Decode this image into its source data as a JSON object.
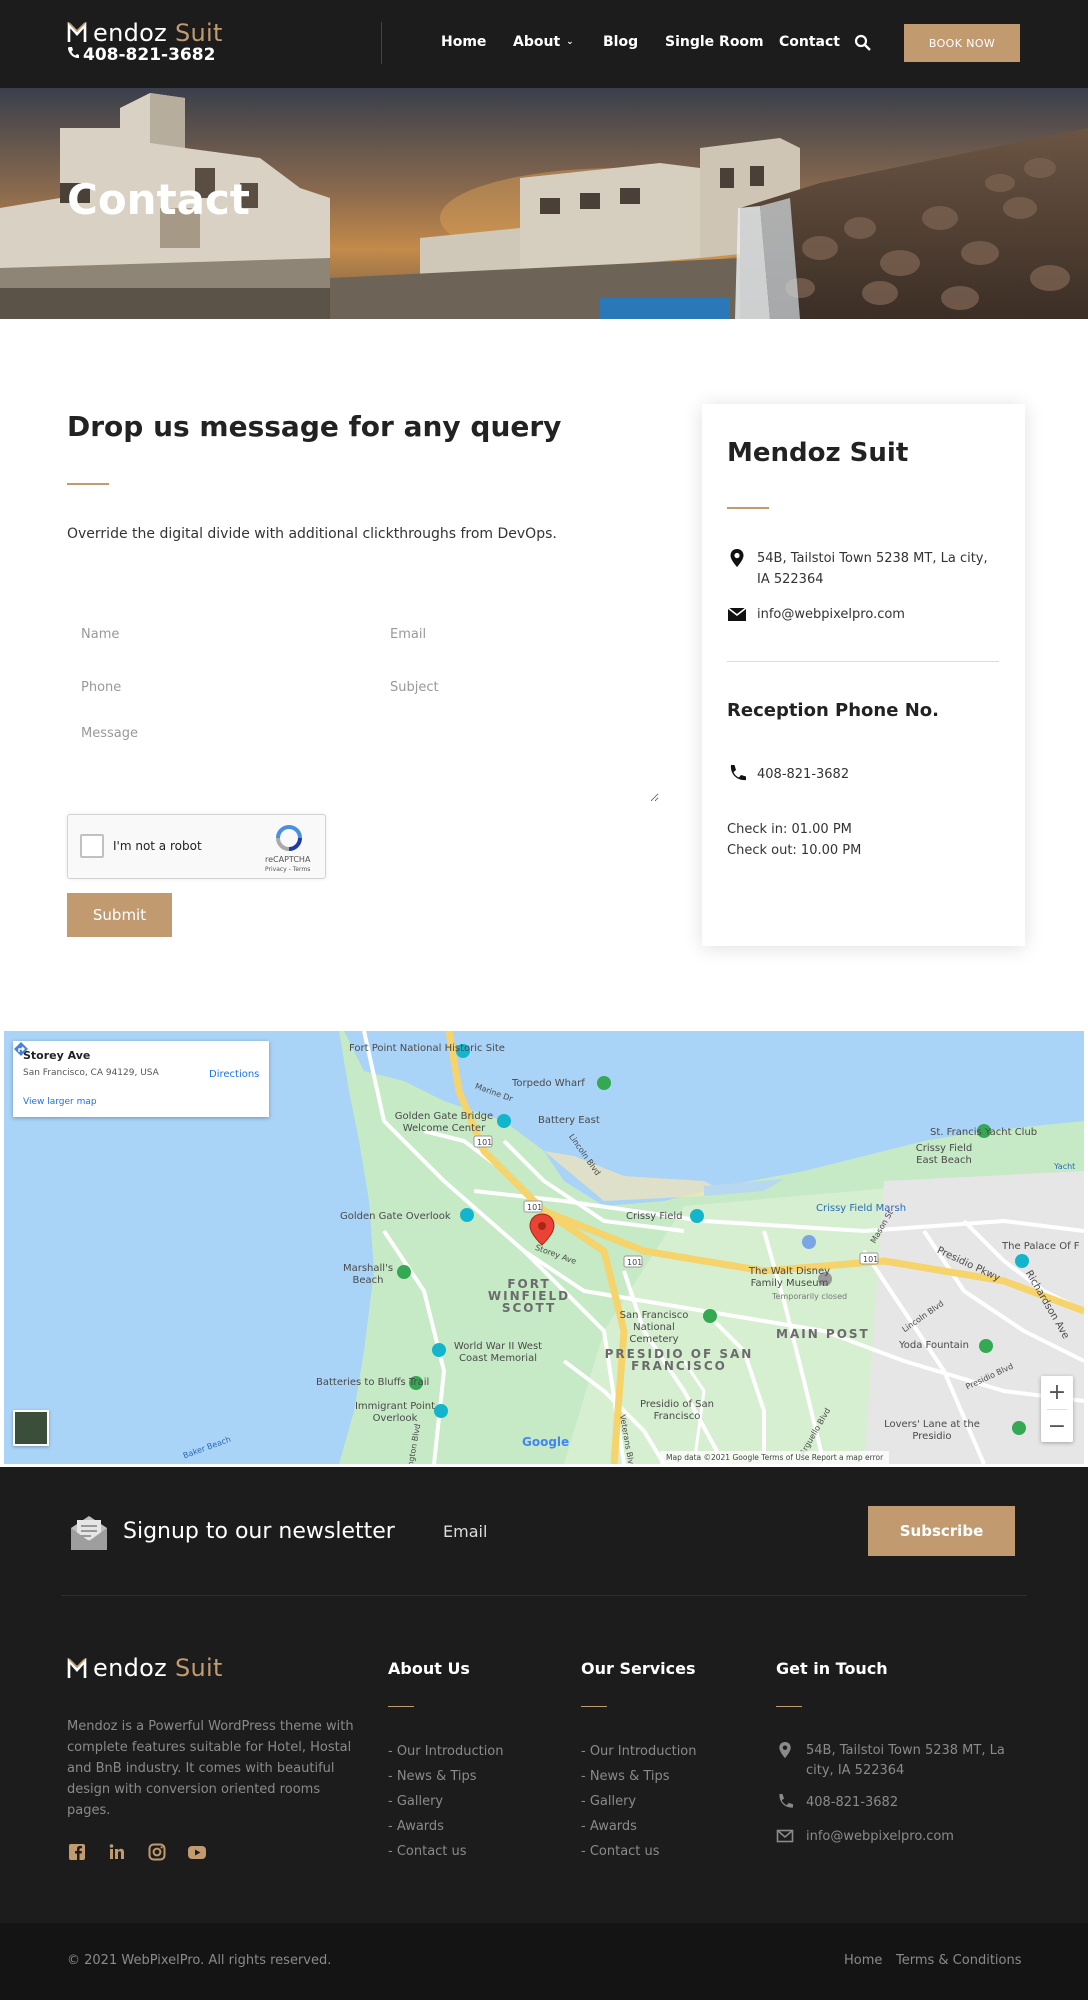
{
  "header": {
    "logo": {
      "letter": "M",
      "text_main": "endoz",
      "text_accent": "Suit",
      "phone": "408-821-3682"
    },
    "nav": [
      {
        "label": "Home"
      },
      {
        "label": "About"
      },
      {
        "label": "Blog"
      },
      {
        "label": "Single Room"
      },
      {
        "label": "Contact"
      }
    ],
    "book_button": "BOOK NOW",
    "search_icon": "search-icon"
  },
  "hero": {
    "title": "Contact"
  },
  "contact_form": {
    "heading": "Drop us message for any query",
    "description": "Override the digital divide with additional clickthroughs from DevOps.",
    "fields": {
      "name_placeholder": "Name",
      "email_placeholder": "Email",
      "phone_placeholder": "Phone",
      "subject_placeholder": "Subject",
      "message_placeholder": "Message"
    },
    "captcha": {
      "label": "I'm not a robot",
      "brand": "reCAPTCHA",
      "terms": "Privacy - Terms"
    },
    "submit_label": "Submit"
  },
  "info_card": {
    "title": "Mendoz Suit",
    "address": "54B, Tailstoi Town 5238 MT, La city, IA 522364",
    "email": "info@webpixelpro.com",
    "reception_title": "Reception Phone No.",
    "phone": "408-821-3682",
    "check_in": "Check in: 01.00 PM",
    "check_out": "Check out: 10.00 PM"
  },
  "map": {
    "place_title": "Storey Ave",
    "place_address": "San Francisco, CA 94129, USA",
    "directions_label": "Directions",
    "larger_map_label": "View larger map",
    "attribution": "Map data ©2021 Google   Terms of Use   Report a map error",
    "google_label": "Google",
    "zoom_in": "+",
    "zoom_out": "−",
    "labels": [
      {
        "text": "Fort Point National Historic Site"
      },
      {
        "text": "Torpedo Wharf"
      },
      {
        "text": "Golden Gate Bridge Welcome Center"
      },
      {
        "text": "Battery East"
      },
      {
        "text": "St. Francis Yacht Club"
      },
      {
        "text": "Crissy Field East Beach"
      },
      {
        "text": "Golden Gate Overlook"
      },
      {
        "text": "Crissy Field"
      },
      {
        "text": "Crissy Field Marsh"
      },
      {
        "text": "Marshall's Beach"
      },
      {
        "text": "FORT WINFIELD SCOTT"
      },
      {
        "text": "The Walt Disney Family Museum"
      },
      {
        "text": "Temporarily closed"
      },
      {
        "text": "The Palace Of F"
      },
      {
        "text": "San Francisco National Cemetery"
      },
      {
        "text": "MAIN POST"
      },
      {
        "text": "Yoda Fountain"
      },
      {
        "text": "World War II West Coast Memorial"
      },
      {
        "text": "PRESIDIO OF SAN FRANCISCO"
      },
      {
        "text": "Batteries to Bluffs Trail"
      },
      {
        "text": "Immigrant Point Overlook"
      },
      {
        "text": "Presidio of San Francisco"
      },
      {
        "text": "Lovers' Lane at the Presidio"
      },
      {
        "text": "Presidio Pkwy"
      },
      {
        "text": "Richardson Ave"
      },
      {
        "text": "Lincoln Blvd"
      },
      {
        "text": "Storey Ave"
      },
      {
        "text": "Marine Dr"
      },
      {
        "text": "Yacht"
      },
      {
        "text": "Baker Beach"
      },
      {
        "text": "Washington Blvd"
      },
      {
        "text": "Arguello Blvd"
      },
      {
        "text": "Veterans Blvd"
      },
      {
        "text": "Mason St"
      },
      {
        "text": "Lincoln Blvd"
      },
      {
        "text": "Presidio Blvd"
      }
    ],
    "route_badges": [
      "101",
      "101",
      "101",
      "1"
    ]
  },
  "newsletter": {
    "title": "Signup to our newsletter",
    "email_placeholder": "Email",
    "subscribe_label": "Subscribe"
  },
  "footer": {
    "logo": {
      "letter": "M",
      "text_main": "endoz",
      "text_accent": "Suit"
    },
    "about_text": "Mendoz is a Powerful WordPress theme with complete features suitable for Hotel, Hostal and BnB industry. It comes with beautiful design with conversion oriented rooms pages.",
    "social": [
      "facebook-icon",
      "linkedin-icon",
      "instagram-icon",
      "youtube-icon"
    ],
    "columns": [
      {
        "title": "About Us",
        "links": [
          "- Our Introduction",
          "- News & Tips",
          "- Gallery",
          "- Awards",
          "- Contact us"
        ]
      },
      {
        "title": "Our Services",
        "links": [
          "- Our Introduction",
          "- News & Tips",
          "- Gallery",
          "- Awards",
          "- Contact us"
        ]
      }
    ],
    "contact": {
      "title": "Get in Touch",
      "address": "54B, Tailstoi Town 5238 MT, La city, IA 522364",
      "phone": "408-821-3682",
      "email": "info@webpixelpro.com"
    },
    "copyright": "© 2021 WebPixelPro. All rights reserved.",
    "bottom_links": [
      "Home",
      "Terms & Conditions"
    ]
  },
  "colors": {
    "accent": "#c29a6f",
    "dark": "#1c1c1c",
    "darker": "#141414"
  }
}
